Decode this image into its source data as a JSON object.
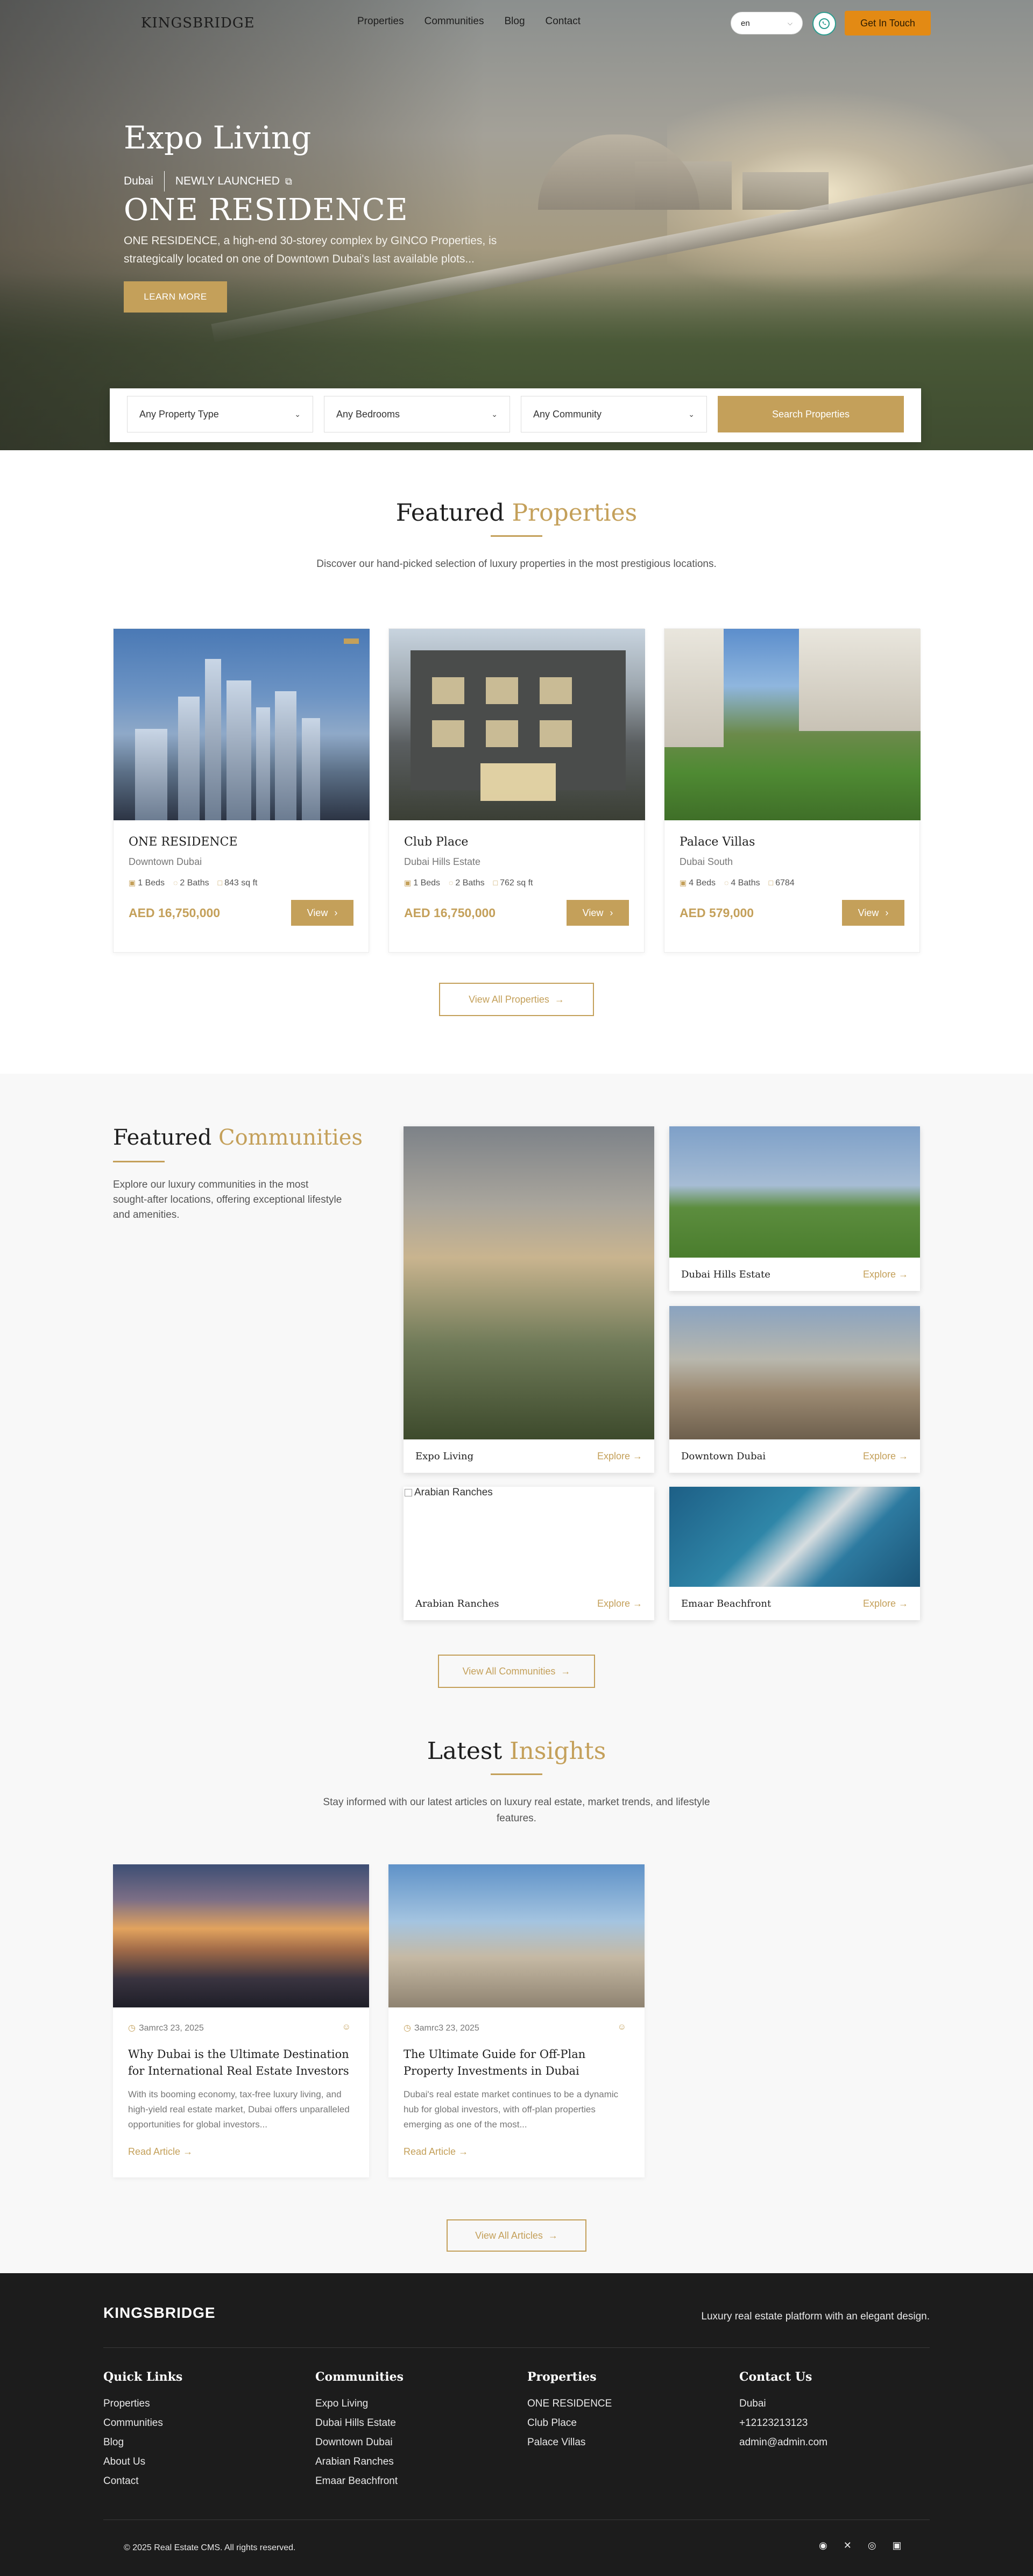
{
  "nav": {
    "logo": "KINGSBRIDGE",
    "links": [
      "Properties",
      "Communities",
      "Blog",
      "Contact"
    ],
    "lang": "en",
    "cta": "Get In Touch"
  },
  "hero": {
    "eyebrow": "Expo Living",
    "city": "Dubai",
    "badge": "NEWLY LAUNCHED",
    "title": "ONE RESIDENCE",
    "description": "ONE RESIDENCE, a high-end 30-storey complex by GINCO Properties, is strategically located on one of Downtown Dubai's last available plots...",
    "learn_more": "LEARN MORE"
  },
  "search": {
    "property_type": "Any Property Type",
    "bedrooms": "Any Bedrooms",
    "community": "Any Community",
    "button": "Search Properties"
  },
  "featured": {
    "title_a": "Featured",
    "title_b": "Properties",
    "subtitle": "Discover our hand-picked selection of luxury properties in the most prestigious locations.",
    "view_label": "View",
    "view_all": "View All Properties",
    "items": [
      {
        "name": "ONE RESIDENCE",
        "location": "Downtown Dubai",
        "beds": "1 Beds",
        "baths": "2 Baths",
        "area": "843 sq ft",
        "price": "AED 16,750,000"
      },
      {
        "name": "Club Place",
        "location": "Dubai Hills Estate",
        "beds": "1 Beds",
        "baths": "2 Baths",
        "area": "762 sq ft",
        "price": "AED 16,750,000"
      },
      {
        "name": "Palace Villas",
        "location": "Dubai South",
        "beds": "4 Beds",
        "baths": "4 Baths",
        "area": "6784",
        "price": "AED 579,000"
      }
    ]
  },
  "communities": {
    "title_a": "Featured",
    "title_b": "Communities",
    "subtitle": "Explore our luxury communities in the most sought-after locations, offering exceptional lifestyle and amenities.",
    "explore": "Explore",
    "view_all": "View All Communities",
    "items": [
      {
        "name": "Expo Living"
      },
      {
        "name": "Dubai Hills Estate"
      },
      {
        "name": "Downtown Dubai"
      },
      {
        "name": "Arabian Ranches",
        "alt": "Arabian Ranches"
      },
      {
        "name": "Emaar Beachfront"
      }
    ]
  },
  "insights": {
    "title_a": "Latest",
    "title_b": "Insights",
    "subtitle": "Stay informed with our latest articles on luxury real estate, market trends, and lifestyle features.",
    "read_more": "Read Article",
    "view_all": "View All Articles",
    "items": [
      {
        "date": "Заmrc3 23, 2025",
        "title": "Why Dubai is the Ultimate Destination for International Real Estate Investors",
        "excerpt": "With its booming economy, tax-free luxury living, and high-yield real estate market, Dubai offers unparalleled opportunities for global investors..."
      },
      {
        "date": "Заmrc3 23, 2025",
        "title": "The Ultimate Guide for Off-Plan Property Investments in Dubai",
        "excerpt": "Dubai's real estate market continues to be a dynamic hub for global investors, with off-plan properties emerging as one of the most..."
      }
    ]
  },
  "footer": {
    "logo": "KINGSBRIDGE",
    "tagline": "Luxury real estate platform with an elegant design.",
    "quick_links": {
      "title": "Quick Links",
      "items": [
        "Properties",
        "Communities",
        "Blog",
        "About Us",
        "Contact"
      ]
    },
    "communities": {
      "title": "Communities",
      "items": [
        "Expo Living",
        "Dubai Hills Estate",
        "Downtown Dubai",
        "Arabian Ranches",
        "Emaar Beachfront"
      ]
    },
    "properties": {
      "title": "Properties",
      "items": [
        "ONE RESIDENCE",
        "Club Place",
        "Palace Villas"
      ]
    },
    "contact": {
      "title": "Contact Us",
      "items": [
        "Dubai",
        "+12123213123",
        "admin@admin.com"
      ]
    },
    "copyright": "© 2025 Real Estate CMS. All rights reserved."
  },
  "colors": {
    "gold": "#c4a05a",
    "cta_orange": "#e38a14",
    "footer_bg": "#1c1c1c"
  },
  "icons": [
    "whatsapp-icon",
    "external-link-icon",
    "chevron-down-icon",
    "bed-icon",
    "bath-icon",
    "area-icon",
    "arrow-right-icon",
    "calendar-icon",
    "user-icon",
    "facebook-icon",
    "x-icon",
    "instagram-icon",
    "linkedin-icon"
  ]
}
